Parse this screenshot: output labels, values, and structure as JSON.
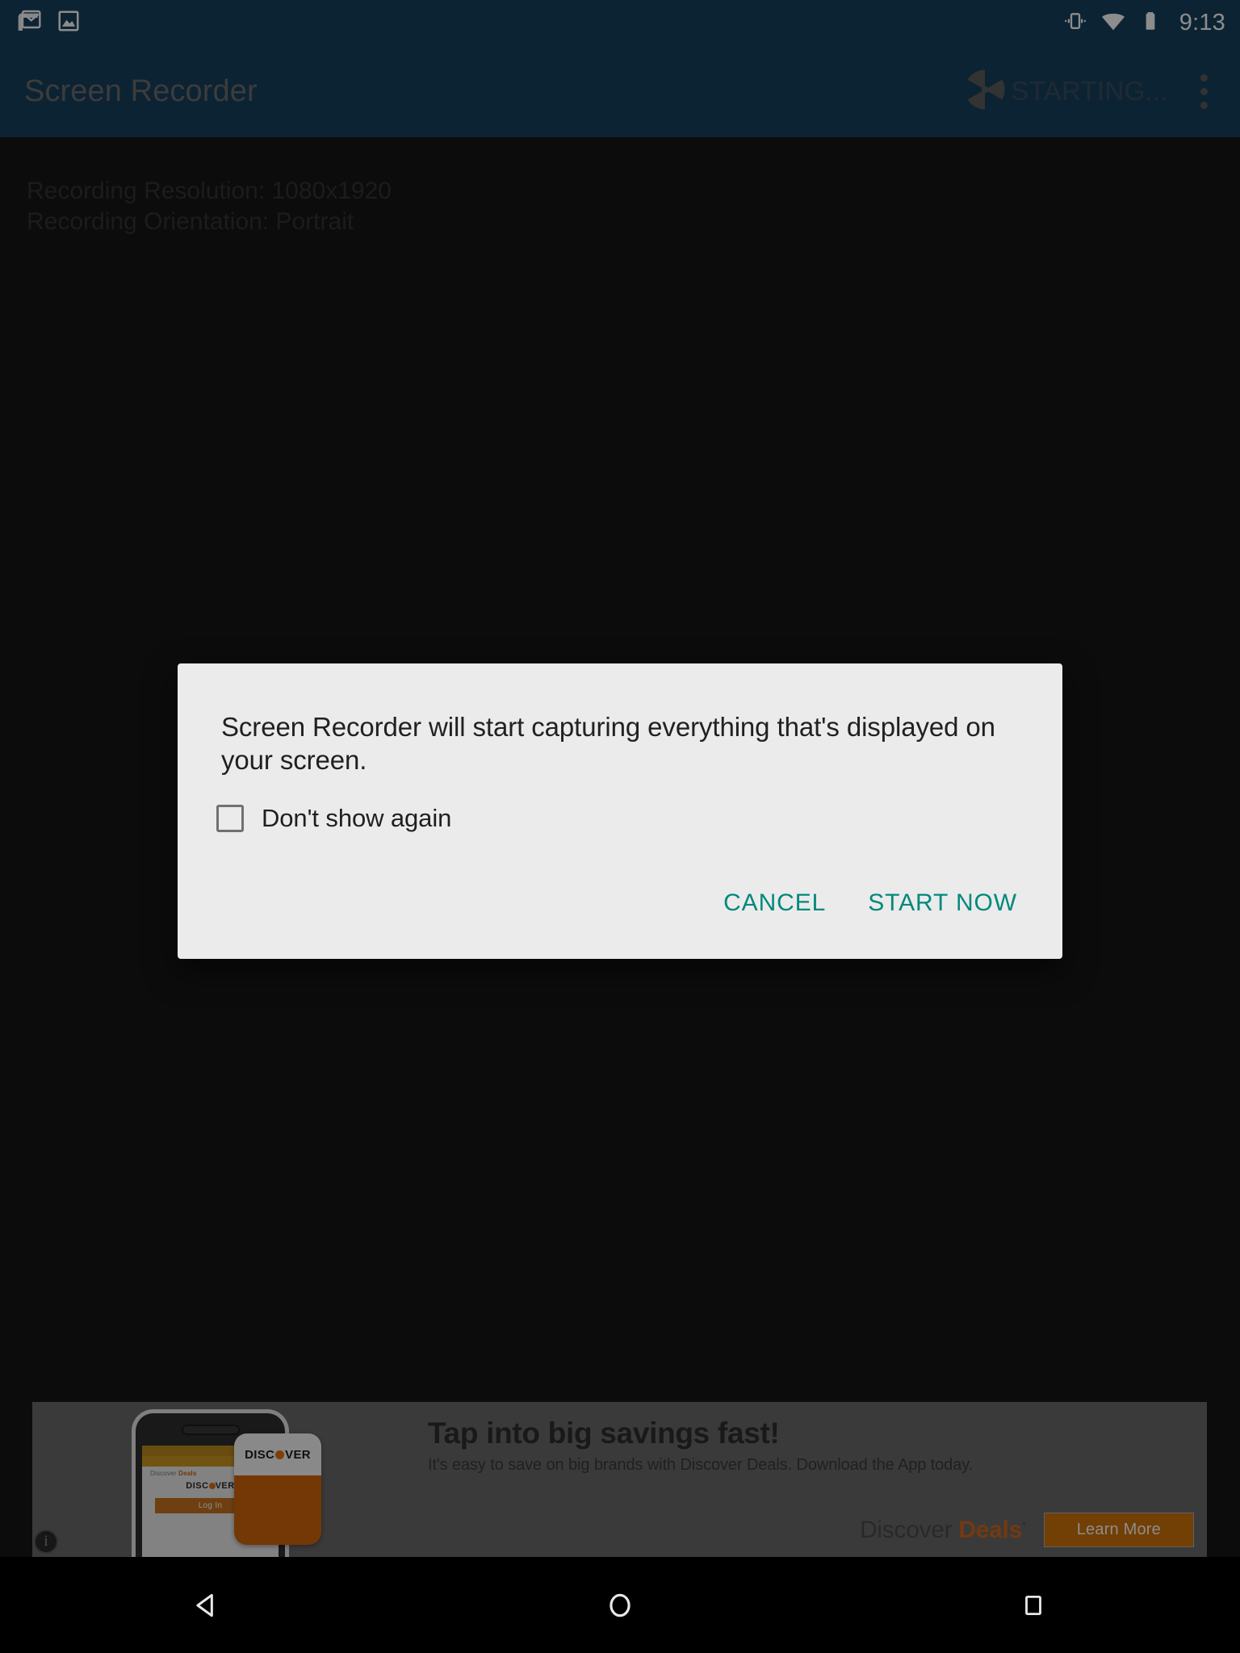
{
  "status_bar": {
    "notification_icons": [
      "gmail-icon",
      "photo-icon"
    ],
    "system_icons": [
      "vibrate-icon",
      "wifi-icon",
      "battery-icon"
    ],
    "time": "9:13"
  },
  "app_bar": {
    "title": "Screen Recorder",
    "recording_state_label": "STARTING...",
    "shutter_icon": "camera-shutter-icon",
    "overflow_icon": "overflow-menu-icon"
  },
  "content": {
    "resolution_line": "Recording Resolution: 1080x1920",
    "orientation_line": "Recording Orientation: Portrait"
  },
  "dialog": {
    "message": "Screen Recorder will start capturing everything that's displayed on your screen.",
    "checkbox_label": "Don't show again",
    "checkbox_checked": false,
    "cancel_label": "CANCEL",
    "confirm_label": "START NOW",
    "accent_color": "#00897b"
  },
  "ad": {
    "headline": "Tap into big savings fast!",
    "subtext": "It's easy to save on big brands with Discover Deals. Download the App today.",
    "logo_first": "Discover ",
    "logo_second": "Deals",
    "logo_mark": "*",
    "cta_label": "Learn More",
    "info_glyph": "i",
    "phone": {
      "app_row_prefix": "Discover ",
      "app_row_suffix": "Deals",
      "brand_pre": "DISC",
      "brand_post": "VER",
      "login_label": "Log In"
    },
    "card": {
      "brand_pre": "DISC",
      "brand_post": "VER"
    },
    "brand_orange": "#d2691e"
  },
  "nav_bar": {
    "back_label": "back-button",
    "home_label": "home-button",
    "recents_label": "recents-button"
  }
}
